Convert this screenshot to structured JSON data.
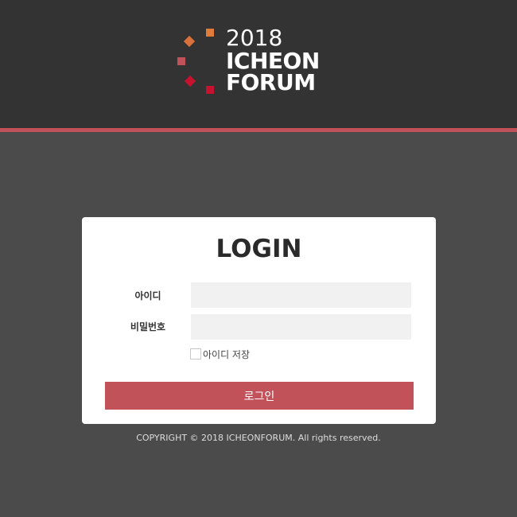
{
  "brand": {
    "year": "2018",
    "name_line1": "ICHEON",
    "name_line2": "FORUM",
    "colors": {
      "header_bg": "#333333",
      "accent_line": "#c2525a",
      "page_bg": "#4b4b4b",
      "logo_orange": "#e07b3a",
      "logo_red": "#c4122f",
      "logo_pink": "#c2525a"
    }
  },
  "login": {
    "title": "LOGIN",
    "id_label": "아이디",
    "id_value": "",
    "password_label": "비밀번호",
    "password_value": "",
    "remember_label": "아이디 저장",
    "remember_checked": false,
    "submit_label": "로그인"
  },
  "footer": {
    "copyright": "COPYRIGHT © 2018 ICHEONFORUM. All rights reserved."
  }
}
